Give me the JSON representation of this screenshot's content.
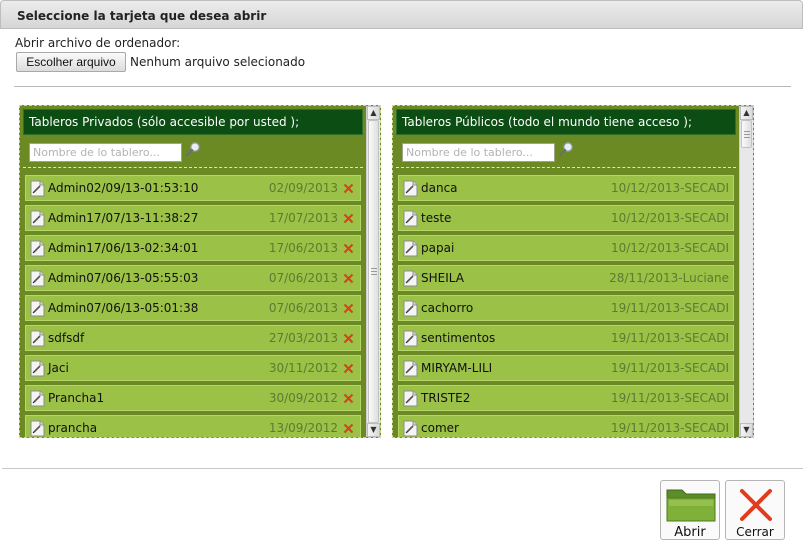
{
  "dialog": {
    "title": "Seleccione la tarjeta que desea abrir"
  },
  "file_open": {
    "label": "Abrir archivo de ordenador:",
    "button_label": "Escolher arquivo",
    "status": "Nenhum arquivo selecionado"
  },
  "private_boards": {
    "header": "Tableros Privados (sólo accesible por usted );",
    "search_placeholder": "Nombre de lo tablero...",
    "items": [
      {
        "name": "Admin02/09/13-01:53:10",
        "date": "02/09/2013"
      },
      {
        "name": "Admin17/07/13-11:38:27",
        "date": "17/07/2013"
      },
      {
        "name": "Admin17/06/13-02:34:01",
        "date": "17/06/2013"
      },
      {
        "name": "Admin07/06/13-05:55:03",
        "date": "07/06/2013"
      },
      {
        "name": "Admin07/06/13-05:01:38",
        "date": "07/06/2013"
      },
      {
        "name": "sdfsdf",
        "date": "27/03/2013"
      },
      {
        "name": "Jaci",
        "date": "30/11/2012"
      },
      {
        "name": "Prancha1",
        "date": "30/09/2012"
      },
      {
        "name": "prancha",
        "date": "13/09/2012"
      }
    ]
  },
  "public_boards": {
    "header": "Tableros Públicos (todo el mundo tiene acceso );",
    "search_placeholder": "Nombre de lo tablero...",
    "items": [
      {
        "name": "danca",
        "date": "10/12/2013-SECADI"
      },
      {
        "name": "teste",
        "date": "10/12/2013-SECADI"
      },
      {
        "name": "papai",
        "date": "10/12/2013-SECADI"
      },
      {
        "name": "SHEILA",
        "date": "28/11/2013-Luciane"
      },
      {
        "name": "cachorro",
        "date": "19/11/2013-SECADI"
      },
      {
        "name": "sentimentos",
        "date": "19/11/2013-SECADI"
      },
      {
        "name": "MIRYAM-LILI",
        "date": "19/11/2013-SECADI"
      },
      {
        "name": "TRISTE2",
        "date": "19/11/2013-SECADI"
      },
      {
        "name": "comer",
        "date": "19/11/2013-SECADI"
      }
    ]
  },
  "actions": {
    "open_label": "Abrir",
    "close_label": "Cerrar"
  },
  "colors": {
    "panel_bg": "#6b8a23",
    "header_bg": "#0b4d12",
    "row_bg": "#9bc146",
    "delete_red": "#e23b1e"
  },
  "icons": [
    "magnifier-icon",
    "document-icon",
    "delete-x-icon",
    "folder-icon",
    "close-x-icon"
  ]
}
